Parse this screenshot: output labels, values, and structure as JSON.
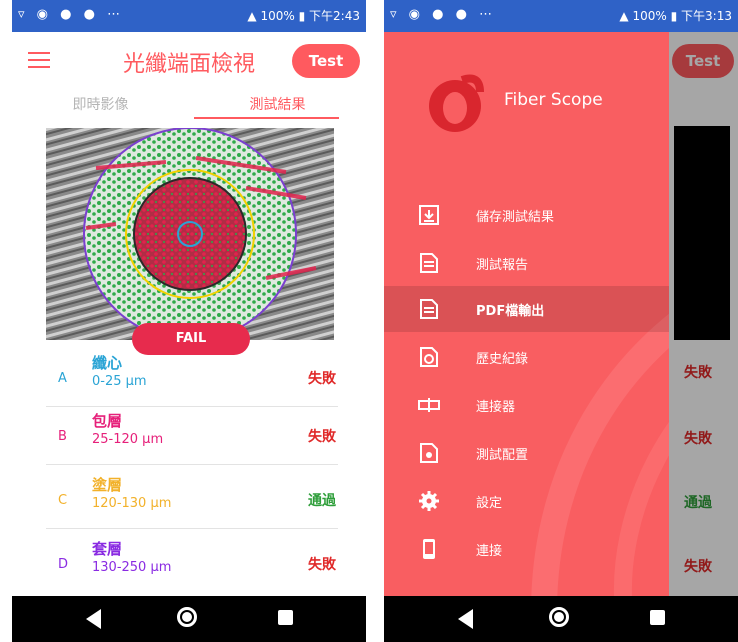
{
  "status_bar": {
    "left_icons": "▿ ◉ ● ●  ⋯",
    "battery": "100%",
    "time_left": "下午2:43",
    "time_right": "下午3:13"
  },
  "screen1": {
    "title": "光纖端面檢視",
    "test_button": "Test",
    "tabs": [
      {
        "label": "即時影像"
      },
      {
        "label": "測試結果"
      }
    ],
    "result_badge": "FAIL",
    "rows": [
      {
        "letter": "A",
        "name": "纖心",
        "range": "0-25 μm",
        "status": "失敗",
        "color": "#2aa4d5",
        "status_color": "#e02a2a"
      },
      {
        "letter": "B",
        "name": "包層",
        "range": "25-120 μm",
        "status": "失敗",
        "color": "#e6207a",
        "status_color": "#e02a2a"
      },
      {
        "letter": "C",
        "name": "塗層",
        "range": "120-130 μm",
        "status": "通過",
        "color": "#f2b12a",
        "status_color": "#2e9e3a"
      },
      {
        "letter": "D",
        "name": "套層",
        "range": "130-250 μm",
        "status": "失敗",
        "color": "#8a2be2",
        "status_color": "#e02a2a"
      }
    ]
  },
  "screen2": {
    "brand": "Fiber Scope",
    "menu": [
      {
        "label": "儲存測試結果",
        "icon": "save-icon"
      },
      {
        "label": "測試報告",
        "icon": "report-icon"
      },
      {
        "label": "PDF檔輸出",
        "icon": "pdf-export-icon",
        "selected": true
      },
      {
        "label": "歷史紀錄",
        "icon": "history-icon"
      },
      {
        "label": "連接器",
        "icon": "connector-icon"
      },
      {
        "label": "測試配置",
        "icon": "test-config-icon"
      },
      {
        "label": "設定",
        "icon": "settings-gear-icon"
      },
      {
        "label": "連接",
        "icon": "device-connect-icon"
      }
    ],
    "behind_test_button": "Test",
    "behind_status": [
      "失敗",
      "失敗",
      "通過",
      "失敗"
    ]
  },
  "colors": {
    "accent": "#ff5a5f",
    "drawer": "#f95e61",
    "status_bar": "#2f62c7",
    "fail_badge": "#e72b4d"
  }
}
